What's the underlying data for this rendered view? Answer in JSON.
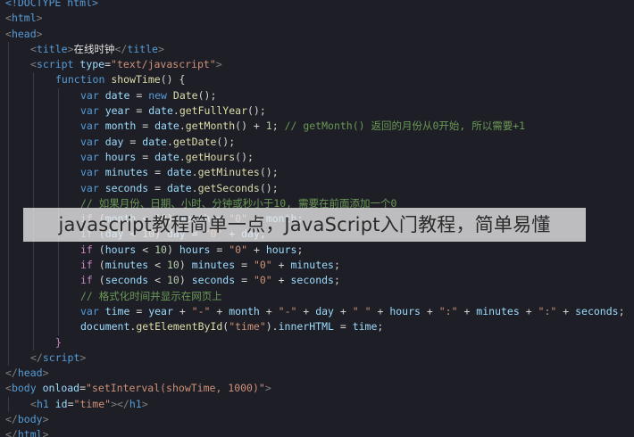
{
  "lines": [
    {
      "indent": 0,
      "tokens": [
        {
          "t": "<!DOCTYPE ",
          "c": "tag"
        },
        {
          "t": "html",
          "c": "tag"
        },
        {
          "t": ">",
          "c": "tag"
        }
      ]
    },
    {
      "indent": 0,
      "tokens": [
        {
          "t": "<",
          "c": "punc"
        },
        {
          "t": "html",
          "c": "tag"
        },
        {
          "t": ">",
          "c": "punc"
        }
      ]
    },
    {
      "indent": 0,
      "tokens": [
        {
          "t": "<",
          "c": "punc"
        },
        {
          "t": "head",
          "c": "tag"
        },
        {
          "t": ">",
          "c": "punc"
        }
      ]
    },
    {
      "indent": 1,
      "tokens": [
        {
          "t": "<",
          "c": "punc"
        },
        {
          "t": "title",
          "c": "tag"
        },
        {
          "t": ">",
          "c": "punc"
        },
        {
          "t": "在线时钟",
          "c": "title"
        },
        {
          "t": "</",
          "c": "punc"
        },
        {
          "t": "title",
          "c": "tag"
        },
        {
          "t": ">",
          "c": "punc"
        }
      ]
    },
    {
      "indent": 1,
      "tokens": [
        {
          "t": "<",
          "c": "punc"
        },
        {
          "t": "script",
          "c": "tag"
        },
        {
          "t": " type",
          "c": "attr"
        },
        {
          "t": "=",
          "c": "op"
        },
        {
          "t": "\"text/javascript\"",
          "c": "str"
        },
        {
          "t": ">",
          "c": "punc"
        }
      ]
    },
    {
      "indent": 2,
      "tokens": [
        {
          "t": "function ",
          "c": "var"
        },
        {
          "t": "showTime",
          "c": "fn"
        },
        {
          "t": "() {",
          "c": "op"
        }
      ]
    },
    {
      "indent": 3,
      "tokens": [
        {
          "t": "var ",
          "c": "var"
        },
        {
          "t": "date",
          "c": "obj"
        },
        {
          "t": " = ",
          "c": "op"
        },
        {
          "t": "new ",
          "c": "var"
        },
        {
          "t": "Date",
          "c": "fn"
        },
        {
          "t": "();",
          "c": "op"
        }
      ]
    },
    {
      "indent": 3,
      "tokens": [
        {
          "t": "var ",
          "c": "var"
        },
        {
          "t": "year",
          "c": "obj"
        },
        {
          "t": " = ",
          "c": "op"
        },
        {
          "t": "date",
          "c": "obj"
        },
        {
          "t": ".",
          "c": "op"
        },
        {
          "t": "getFullYear",
          "c": "fn"
        },
        {
          "t": "();",
          "c": "op"
        }
      ]
    },
    {
      "indent": 3,
      "tokens": [
        {
          "t": "var ",
          "c": "var"
        },
        {
          "t": "month",
          "c": "obj"
        },
        {
          "t": " = ",
          "c": "op"
        },
        {
          "t": "date",
          "c": "obj"
        },
        {
          "t": ".",
          "c": "op"
        },
        {
          "t": "getMonth",
          "c": "fn"
        },
        {
          "t": "() + ",
          "c": "op"
        },
        {
          "t": "1",
          "c": "num"
        },
        {
          "t": "; ",
          "c": "op"
        },
        {
          "t": "// getMonth() 返回的月份从0开始, 所以需要+1",
          "c": "cmt"
        }
      ]
    },
    {
      "indent": 3,
      "tokens": [
        {
          "t": "var ",
          "c": "var"
        },
        {
          "t": "day",
          "c": "obj"
        },
        {
          "t": " = ",
          "c": "op"
        },
        {
          "t": "date",
          "c": "obj"
        },
        {
          "t": ".",
          "c": "op"
        },
        {
          "t": "getDate",
          "c": "fn"
        },
        {
          "t": "();",
          "c": "op"
        }
      ]
    },
    {
      "indent": 3,
      "tokens": [
        {
          "t": "var ",
          "c": "var"
        },
        {
          "t": "hours",
          "c": "obj"
        },
        {
          "t": " = ",
          "c": "op"
        },
        {
          "t": "date",
          "c": "obj"
        },
        {
          "t": ".",
          "c": "op"
        },
        {
          "t": "getHours",
          "c": "fn"
        },
        {
          "t": "();",
          "c": "op"
        }
      ]
    },
    {
      "indent": 3,
      "tokens": [
        {
          "t": "var ",
          "c": "var"
        },
        {
          "t": "minutes",
          "c": "obj"
        },
        {
          "t": " = ",
          "c": "op"
        },
        {
          "t": "date",
          "c": "obj"
        },
        {
          "t": ".",
          "c": "op"
        },
        {
          "t": "getMinutes",
          "c": "fn"
        },
        {
          "t": "();",
          "c": "op"
        }
      ]
    },
    {
      "indent": 3,
      "tokens": [
        {
          "t": "var ",
          "c": "var"
        },
        {
          "t": "seconds",
          "c": "obj"
        },
        {
          "t": " = ",
          "c": "op"
        },
        {
          "t": "date",
          "c": "obj"
        },
        {
          "t": ".",
          "c": "op"
        },
        {
          "t": "getSeconds",
          "c": "fn"
        },
        {
          "t": "();",
          "c": "op"
        }
      ]
    },
    {
      "indent": 3,
      "tokens": [
        {
          "t": "// 如果月份、日期、小时、分钟或秒小于10, 需要在前面添加一个0",
          "c": "cmt"
        }
      ]
    },
    {
      "indent": 3,
      "tokens": [
        {
          "t": "if ",
          "c": "kw"
        },
        {
          "t": "(",
          "c": "op"
        },
        {
          "t": "month",
          "c": "obj"
        },
        {
          "t": " < ",
          "c": "op"
        },
        {
          "t": "10",
          "c": "num"
        },
        {
          "t": ") ",
          "c": "op"
        },
        {
          "t": "month",
          "c": "obj"
        },
        {
          "t": " = ",
          "c": "op"
        },
        {
          "t": "\"0\"",
          "c": "str"
        },
        {
          "t": " + ",
          "c": "op"
        },
        {
          "t": "month",
          "c": "obj"
        },
        {
          "t": ";",
          "c": "op"
        }
      ]
    },
    {
      "indent": 3,
      "tokens": [
        {
          "t": "if ",
          "c": "kw"
        },
        {
          "t": "(",
          "c": "op"
        },
        {
          "t": "day",
          "c": "obj"
        },
        {
          "t": " < ",
          "c": "op"
        },
        {
          "t": "10",
          "c": "num"
        },
        {
          "t": ") ",
          "c": "op"
        },
        {
          "t": "day",
          "c": "obj"
        },
        {
          "t": " = ",
          "c": "op"
        },
        {
          "t": "\"0\"",
          "c": "str"
        },
        {
          "t": " + ",
          "c": "op"
        },
        {
          "t": "day",
          "c": "obj"
        },
        {
          "t": ";",
          "c": "op"
        }
      ]
    },
    {
      "indent": 3,
      "tokens": [
        {
          "t": "if ",
          "c": "kw"
        },
        {
          "t": "(",
          "c": "op"
        },
        {
          "t": "hours",
          "c": "obj"
        },
        {
          "t": " < ",
          "c": "op"
        },
        {
          "t": "10",
          "c": "num"
        },
        {
          "t": ") ",
          "c": "op"
        },
        {
          "t": "hours",
          "c": "obj"
        },
        {
          "t": " = ",
          "c": "op"
        },
        {
          "t": "\"0\"",
          "c": "str"
        },
        {
          "t": " + ",
          "c": "op"
        },
        {
          "t": "hours",
          "c": "obj"
        },
        {
          "t": ";",
          "c": "op"
        }
      ]
    },
    {
      "indent": 3,
      "tokens": [
        {
          "t": "if ",
          "c": "kw"
        },
        {
          "t": "(",
          "c": "op"
        },
        {
          "t": "minutes",
          "c": "obj"
        },
        {
          "t": " < ",
          "c": "op"
        },
        {
          "t": "10",
          "c": "num"
        },
        {
          "t": ") ",
          "c": "op"
        },
        {
          "t": "minutes",
          "c": "obj"
        },
        {
          "t": " = ",
          "c": "op"
        },
        {
          "t": "\"0\"",
          "c": "str"
        },
        {
          "t": " + ",
          "c": "op"
        },
        {
          "t": "minutes",
          "c": "obj"
        },
        {
          "t": ";",
          "c": "op"
        }
      ]
    },
    {
      "indent": 3,
      "tokens": [
        {
          "t": "if ",
          "c": "kw"
        },
        {
          "t": "(",
          "c": "op"
        },
        {
          "t": "seconds",
          "c": "obj"
        },
        {
          "t": " < ",
          "c": "op"
        },
        {
          "t": "10",
          "c": "num"
        },
        {
          "t": ") ",
          "c": "op"
        },
        {
          "t": "seconds",
          "c": "obj"
        },
        {
          "t": " = ",
          "c": "op"
        },
        {
          "t": "\"0\"",
          "c": "str"
        },
        {
          "t": " + ",
          "c": "op"
        },
        {
          "t": "seconds",
          "c": "obj"
        },
        {
          "t": ";",
          "c": "op"
        }
      ]
    },
    {
      "indent": 3,
      "tokens": [
        {
          "t": "// 格式化时间并显示在网页上",
          "c": "cmt"
        }
      ]
    },
    {
      "indent": 3,
      "tokens": [
        {
          "t": "var ",
          "c": "var"
        },
        {
          "t": "time",
          "c": "obj"
        },
        {
          "t": " = ",
          "c": "op"
        },
        {
          "t": "year",
          "c": "obj"
        },
        {
          "t": " + ",
          "c": "op"
        },
        {
          "t": "\"-\"",
          "c": "str"
        },
        {
          "t": " + ",
          "c": "op"
        },
        {
          "t": "month",
          "c": "obj"
        },
        {
          "t": " + ",
          "c": "op"
        },
        {
          "t": "\"-\"",
          "c": "str"
        },
        {
          "t": " + ",
          "c": "op"
        },
        {
          "t": "day",
          "c": "obj"
        },
        {
          "t": " + ",
          "c": "op"
        },
        {
          "t": "\" \"",
          "c": "str"
        },
        {
          "t": " + ",
          "c": "op"
        },
        {
          "t": "hours",
          "c": "obj"
        },
        {
          "t": " + ",
          "c": "op"
        },
        {
          "t": "\":\"",
          "c": "str"
        },
        {
          "t": " + ",
          "c": "op"
        },
        {
          "t": "minutes",
          "c": "obj"
        },
        {
          "t": " + ",
          "c": "op"
        },
        {
          "t": "\":\"",
          "c": "str"
        },
        {
          "t": " + ",
          "c": "op"
        },
        {
          "t": "seconds",
          "c": "obj"
        },
        {
          "t": ";",
          "c": "op"
        }
      ]
    },
    {
      "indent": 3,
      "tokens": [
        {
          "t": "document",
          "c": "obj"
        },
        {
          "t": ".",
          "c": "op"
        },
        {
          "t": "getElementById",
          "c": "fn"
        },
        {
          "t": "(",
          "c": "op"
        },
        {
          "t": "\"time\"",
          "c": "str"
        },
        {
          "t": ").",
          "c": "op"
        },
        {
          "t": "innerHTML",
          "c": "obj"
        },
        {
          "t": " = ",
          "c": "op"
        },
        {
          "t": "time",
          "c": "obj"
        },
        {
          "t": ";",
          "c": "op"
        }
      ]
    },
    {
      "indent": 2,
      "tokens": [
        {
          "t": "}",
          "c": "kw"
        }
      ]
    },
    {
      "indent": 1,
      "tokens": [
        {
          "t": "</",
          "c": "punc"
        },
        {
          "t": "script",
          "c": "tag"
        },
        {
          "t": ">",
          "c": "punc"
        }
      ]
    },
    {
      "indent": 0,
      "tokens": [
        {
          "t": "</",
          "c": "punc"
        },
        {
          "t": "head",
          "c": "tag"
        },
        {
          "t": ">",
          "c": "punc"
        }
      ]
    },
    {
      "indent": 0,
      "tokens": [
        {
          "t": "<",
          "c": "punc"
        },
        {
          "t": "body",
          "c": "tag"
        },
        {
          "t": " onload",
          "c": "attr"
        },
        {
          "t": "=",
          "c": "op"
        },
        {
          "t": "\"setInterval(showTime, 1000)\"",
          "c": "str"
        },
        {
          "t": ">",
          "c": "punc"
        }
      ]
    },
    {
      "indent": 1,
      "tokens": [
        {
          "t": "<",
          "c": "punc"
        },
        {
          "t": "h1",
          "c": "tag"
        },
        {
          "t": " id",
          "c": "attr"
        },
        {
          "t": "=",
          "c": "op"
        },
        {
          "t": "\"time\"",
          "c": "str"
        },
        {
          "t": "></",
          "c": "punc"
        },
        {
          "t": "h1",
          "c": "tag"
        },
        {
          "t": ">",
          "c": "punc"
        }
      ]
    },
    {
      "indent": 0,
      "tokens": [
        {
          "t": "</",
          "c": "punc"
        },
        {
          "t": "body",
          "c": "tag"
        },
        {
          "t": ">",
          "c": "punc"
        }
      ]
    },
    {
      "indent": 0,
      "tokens": [
        {
          "t": "</",
          "c": "punc"
        },
        {
          "t": "html",
          "c": "tag"
        },
        {
          "t": ">",
          "c": "punc"
        }
      ]
    }
  ],
  "overlay": {
    "caption": "javascript教程简单一点，JavaScript入门教程，简单易懂"
  },
  "colors": {
    "background": "#1e1e26",
    "tag": "#569cd6",
    "attribute": "#9cdcfe",
    "string": "#ce9178",
    "comment": "#6a9955",
    "function": "#dcdcaa",
    "number": "#b5cea8"
  }
}
